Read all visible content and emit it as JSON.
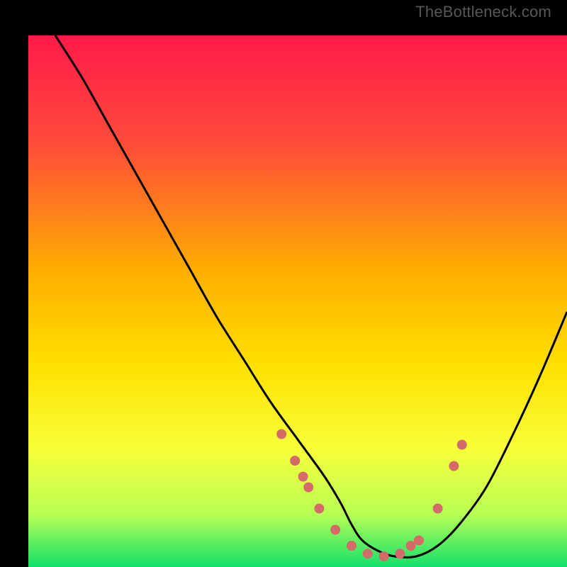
{
  "watermark": "TheBottleneck.com",
  "chart_data": {
    "type": "line",
    "title": "",
    "xlabel": "",
    "ylabel": "",
    "xlim": [
      0,
      100
    ],
    "ylim": [
      0,
      100
    ],
    "grid": false,
    "legend": false,
    "gradient_stops": [
      {
        "offset": 0,
        "color": "#ff1a4b"
      },
      {
        "offset": 0.2,
        "color": "#ff4a3a"
      },
      {
        "offset": 0.45,
        "color": "#ffb000"
      },
      {
        "offset": 0.62,
        "color": "#ffe000"
      },
      {
        "offset": 0.78,
        "color": "#f7ff3a"
      },
      {
        "offset": 0.9,
        "color": "#b8ff55"
      },
      {
        "offset": 1.0,
        "color": "#13e06a"
      }
    ],
    "series": [
      {
        "name": "bottleneck-curve",
        "x": [
          5,
          10,
          15,
          20,
          25,
          30,
          35,
          40,
          45,
          50,
          55,
          58,
          60,
          62,
          65,
          68,
          72,
          76,
          80,
          85,
          90,
          95,
          100
        ],
        "y": [
          100,
          92,
          83,
          74,
          65,
          56,
          47,
          39,
          31,
          24,
          17,
          12,
          8,
          5,
          3,
          2,
          2,
          4,
          8,
          15,
          25,
          36,
          48
        ]
      }
    ],
    "points": {
      "name": "sample-points",
      "color": "#d46a6a",
      "x": [
        47,
        49.5,
        51,
        52,
        54,
        57,
        60,
        63,
        66,
        69,
        71,
        72.5,
        76,
        79,
        80.5
      ],
      "y": [
        25,
        20,
        17,
        15,
        11,
        7,
        4,
        2.5,
        2,
        2.5,
        4,
        5,
        11,
        19,
        23
      ]
    }
  }
}
